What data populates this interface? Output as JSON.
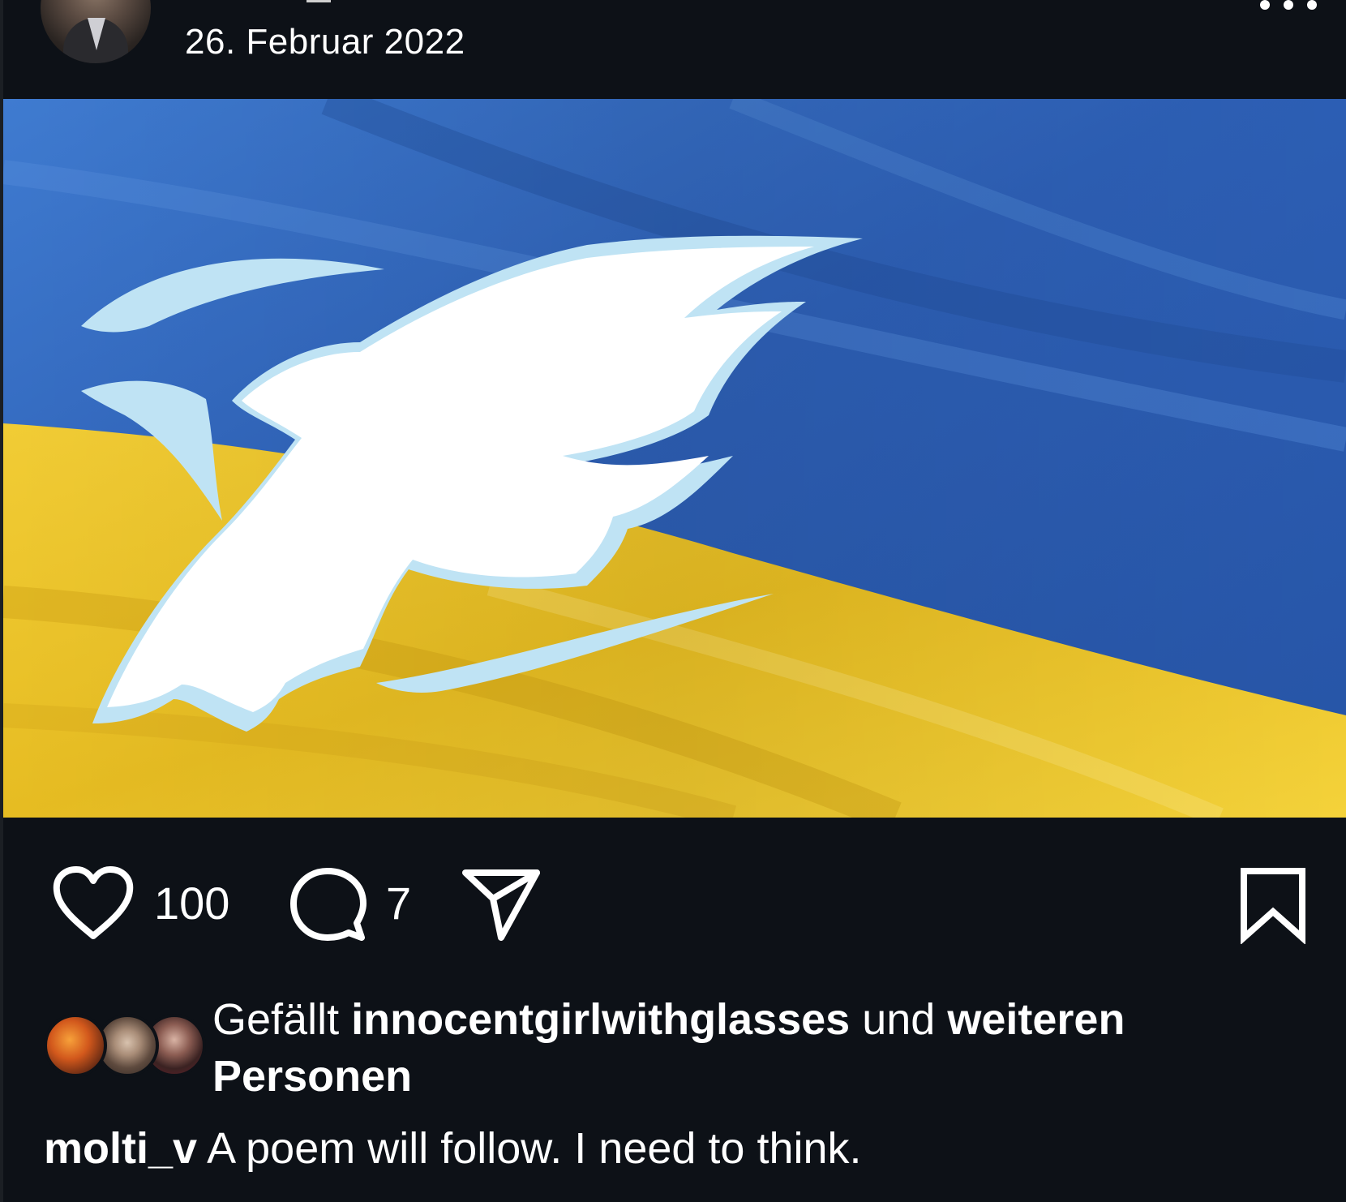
{
  "post": {
    "date": "26. Februar 2022"
  },
  "image": {
    "flag_top_color": "#2f63b8",
    "flag_bottom_color": "#f2cf2e",
    "dove_color": "#ffffff",
    "dove_outline_color": "#bfe3f4"
  },
  "actions": {
    "like_count": "100",
    "comment_count": "7",
    "icons": [
      "heart-icon",
      "comment-icon",
      "share-icon",
      "bookmark-icon"
    ]
  },
  "likes": {
    "prefix": "Gefällt",
    "user": "innocentgirlwithglasses",
    "connector": "und",
    "others": "weiteren Personen"
  },
  "caption": {
    "username": "molti_v",
    "text": "A poem will follow. I need to think."
  },
  "colors": {
    "background": "#0d1117",
    "text": "#ffffff"
  }
}
